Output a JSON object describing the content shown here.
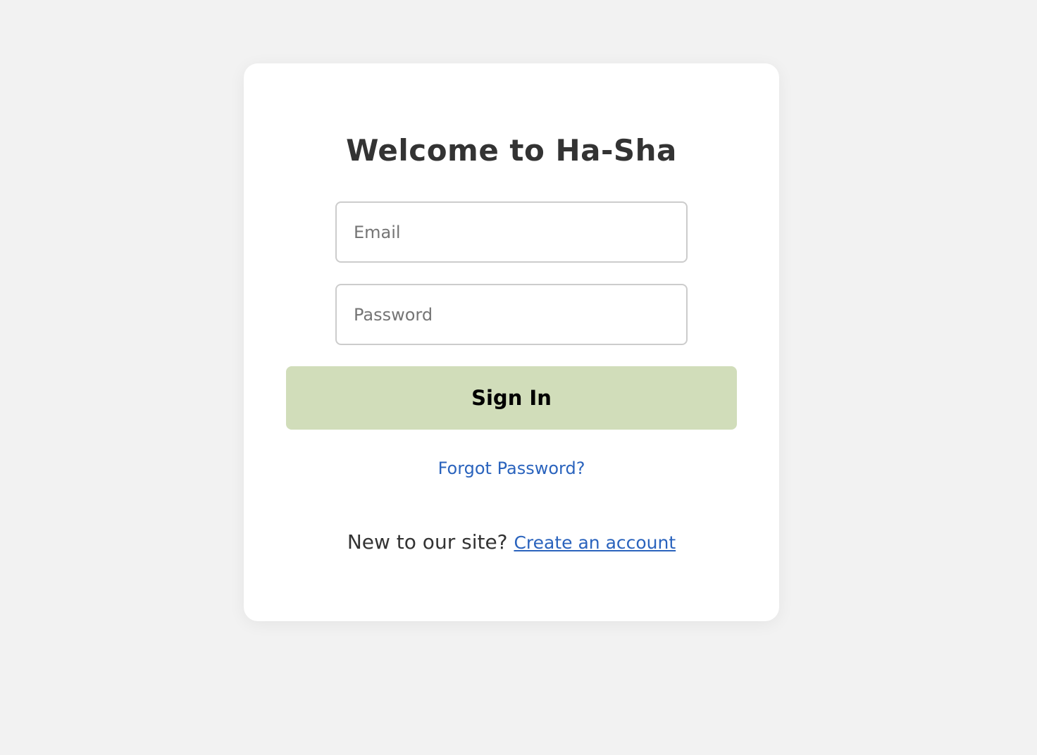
{
  "login": {
    "title": "Welcome to Ha-Sha",
    "email": {
      "placeholder": "Email",
      "value": ""
    },
    "password": {
      "placeholder": "Password",
      "value": ""
    },
    "sign_in_label": "Sign In",
    "forgot_password_label": "Forgot Password?",
    "signup_prompt": "New to our site?",
    "create_account_label": "Create an account"
  },
  "colors": {
    "page_background": "#f2f2f2",
    "card_background": "#ffffff",
    "button_background": "#d1ddba",
    "link": "#2a63bd",
    "text": "#333333"
  }
}
